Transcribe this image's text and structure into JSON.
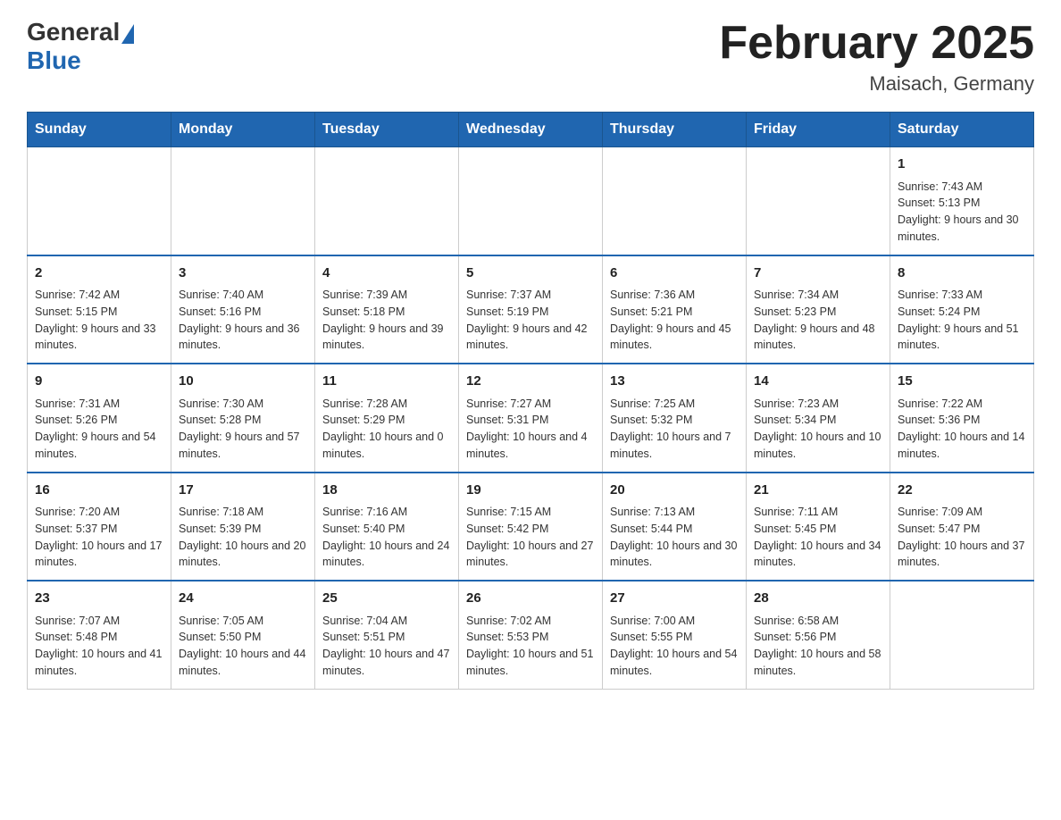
{
  "header": {
    "logo_general": "General",
    "logo_blue": "Blue",
    "month_title": "February 2025",
    "location": "Maisach, Germany"
  },
  "days_of_week": [
    "Sunday",
    "Monday",
    "Tuesday",
    "Wednesday",
    "Thursday",
    "Friday",
    "Saturday"
  ],
  "weeks": [
    {
      "days": [
        {
          "num": "",
          "info": ""
        },
        {
          "num": "",
          "info": ""
        },
        {
          "num": "",
          "info": ""
        },
        {
          "num": "",
          "info": ""
        },
        {
          "num": "",
          "info": ""
        },
        {
          "num": "",
          "info": ""
        },
        {
          "num": "1",
          "info": "Sunrise: 7:43 AM\nSunset: 5:13 PM\nDaylight: 9 hours and 30 minutes."
        }
      ]
    },
    {
      "days": [
        {
          "num": "2",
          "info": "Sunrise: 7:42 AM\nSunset: 5:15 PM\nDaylight: 9 hours and 33 minutes."
        },
        {
          "num": "3",
          "info": "Sunrise: 7:40 AM\nSunset: 5:16 PM\nDaylight: 9 hours and 36 minutes."
        },
        {
          "num": "4",
          "info": "Sunrise: 7:39 AM\nSunset: 5:18 PM\nDaylight: 9 hours and 39 minutes."
        },
        {
          "num": "5",
          "info": "Sunrise: 7:37 AM\nSunset: 5:19 PM\nDaylight: 9 hours and 42 minutes."
        },
        {
          "num": "6",
          "info": "Sunrise: 7:36 AM\nSunset: 5:21 PM\nDaylight: 9 hours and 45 minutes."
        },
        {
          "num": "7",
          "info": "Sunrise: 7:34 AM\nSunset: 5:23 PM\nDaylight: 9 hours and 48 minutes."
        },
        {
          "num": "8",
          "info": "Sunrise: 7:33 AM\nSunset: 5:24 PM\nDaylight: 9 hours and 51 minutes."
        }
      ]
    },
    {
      "days": [
        {
          "num": "9",
          "info": "Sunrise: 7:31 AM\nSunset: 5:26 PM\nDaylight: 9 hours and 54 minutes."
        },
        {
          "num": "10",
          "info": "Sunrise: 7:30 AM\nSunset: 5:28 PM\nDaylight: 9 hours and 57 minutes."
        },
        {
          "num": "11",
          "info": "Sunrise: 7:28 AM\nSunset: 5:29 PM\nDaylight: 10 hours and 0 minutes."
        },
        {
          "num": "12",
          "info": "Sunrise: 7:27 AM\nSunset: 5:31 PM\nDaylight: 10 hours and 4 minutes."
        },
        {
          "num": "13",
          "info": "Sunrise: 7:25 AM\nSunset: 5:32 PM\nDaylight: 10 hours and 7 minutes."
        },
        {
          "num": "14",
          "info": "Sunrise: 7:23 AM\nSunset: 5:34 PM\nDaylight: 10 hours and 10 minutes."
        },
        {
          "num": "15",
          "info": "Sunrise: 7:22 AM\nSunset: 5:36 PM\nDaylight: 10 hours and 14 minutes."
        }
      ]
    },
    {
      "days": [
        {
          "num": "16",
          "info": "Sunrise: 7:20 AM\nSunset: 5:37 PM\nDaylight: 10 hours and 17 minutes."
        },
        {
          "num": "17",
          "info": "Sunrise: 7:18 AM\nSunset: 5:39 PM\nDaylight: 10 hours and 20 minutes."
        },
        {
          "num": "18",
          "info": "Sunrise: 7:16 AM\nSunset: 5:40 PM\nDaylight: 10 hours and 24 minutes."
        },
        {
          "num": "19",
          "info": "Sunrise: 7:15 AM\nSunset: 5:42 PM\nDaylight: 10 hours and 27 minutes."
        },
        {
          "num": "20",
          "info": "Sunrise: 7:13 AM\nSunset: 5:44 PM\nDaylight: 10 hours and 30 minutes."
        },
        {
          "num": "21",
          "info": "Sunrise: 7:11 AM\nSunset: 5:45 PM\nDaylight: 10 hours and 34 minutes."
        },
        {
          "num": "22",
          "info": "Sunrise: 7:09 AM\nSunset: 5:47 PM\nDaylight: 10 hours and 37 minutes."
        }
      ]
    },
    {
      "days": [
        {
          "num": "23",
          "info": "Sunrise: 7:07 AM\nSunset: 5:48 PM\nDaylight: 10 hours and 41 minutes."
        },
        {
          "num": "24",
          "info": "Sunrise: 7:05 AM\nSunset: 5:50 PM\nDaylight: 10 hours and 44 minutes."
        },
        {
          "num": "25",
          "info": "Sunrise: 7:04 AM\nSunset: 5:51 PM\nDaylight: 10 hours and 47 minutes."
        },
        {
          "num": "26",
          "info": "Sunrise: 7:02 AM\nSunset: 5:53 PM\nDaylight: 10 hours and 51 minutes."
        },
        {
          "num": "27",
          "info": "Sunrise: 7:00 AM\nSunset: 5:55 PM\nDaylight: 10 hours and 54 minutes."
        },
        {
          "num": "28",
          "info": "Sunrise: 6:58 AM\nSunset: 5:56 PM\nDaylight: 10 hours and 58 minutes."
        },
        {
          "num": "",
          "info": ""
        }
      ]
    }
  ]
}
